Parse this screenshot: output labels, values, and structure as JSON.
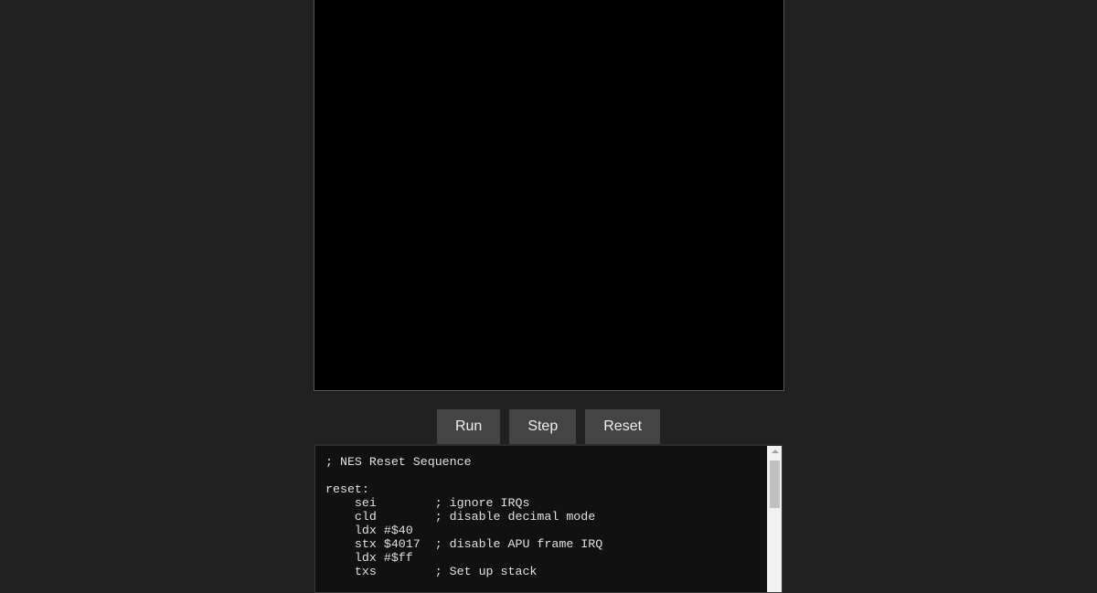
{
  "controls": {
    "run_label": "Run",
    "step_label": "Step",
    "reset_label": "Reset"
  },
  "editor": {
    "lines": [
      "; NES Reset Sequence",
      "",
      "reset:",
      "    sei        ; ignore IRQs",
      "    cld        ; disable decimal mode",
      "    ldx #$40",
      "    stx $4017  ; disable APU frame IRQ",
      "    ldx #$ff",
      "    txs        ; Set up stack"
    ]
  }
}
